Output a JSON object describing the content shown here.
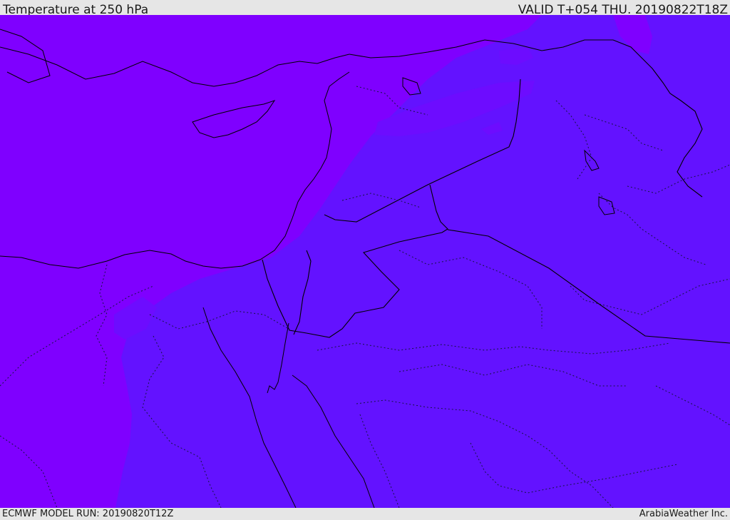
{
  "header": {
    "title": "Temperature at 250 hPa",
    "valid_time": "VALID T+054 THU. 20190822T18Z"
  },
  "footer": {
    "model_run": "ECMWF MODEL RUN: 20190820T12Z",
    "credit": "ArabiaWeather Inc."
  },
  "map": {
    "field": "Temperature at 250 hPa",
    "colors": {
      "warm_band": "#7f00ff",
      "main_field": "#6312ff",
      "mid_patch": "#6d0cff",
      "coastline": "#000000",
      "border": "#000000",
      "subregion": "#1a1a4a"
    }
  }
}
